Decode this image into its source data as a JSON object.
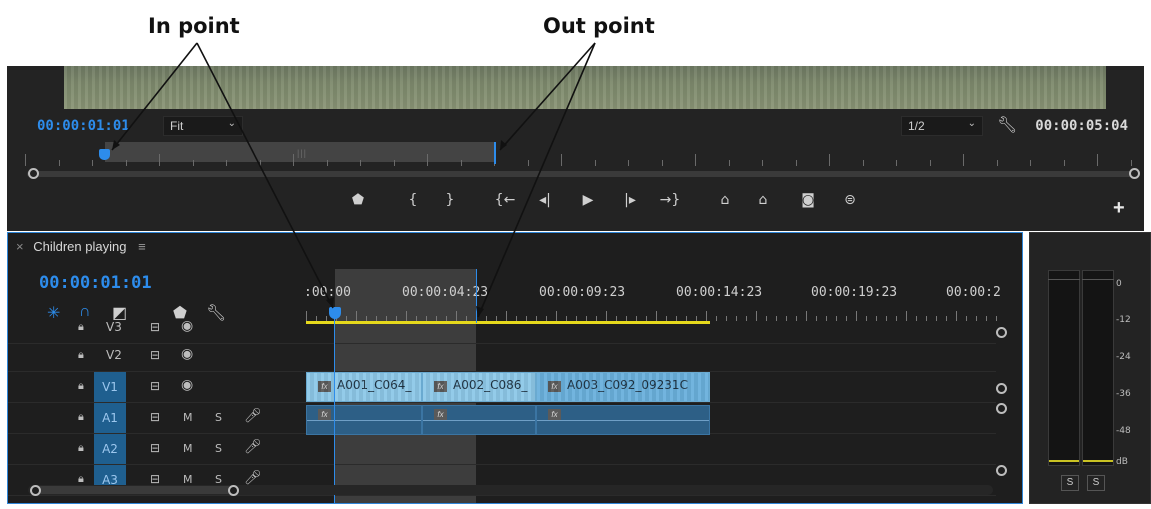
{
  "annotations": {
    "in_point": "In point",
    "out_point": "Out point"
  },
  "program_monitor": {
    "current_timecode": "00:00:01:01",
    "zoom": "Fit",
    "resolution": "1/2",
    "duration": "00:00:05:04",
    "transport_buttons": [
      {
        "name": "add-marker",
        "glyph": "⬟"
      },
      {
        "name": "mark-in",
        "glyph": "{"
      },
      {
        "name": "mark-out",
        "glyph": "}"
      },
      {
        "name": "go-to-in",
        "glyph": "{←"
      },
      {
        "name": "step-back",
        "glyph": "◂|"
      },
      {
        "name": "play",
        "glyph": "▶"
      },
      {
        "name": "step-forward",
        "glyph": "|▸"
      },
      {
        "name": "go-to-out",
        "glyph": "→}"
      },
      {
        "name": "lift",
        "glyph": "⌂"
      },
      {
        "name": "extract",
        "glyph": "⌂"
      },
      {
        "name": "export-frame",
        "glyph": "◙"
      },
      {
        "name": "comparison-view",
        "glyph": "⊜"
      }
    ],
    "add_button": "+"
  },
  "timeline": {
    "sequence_name": "Children playing",
    "timecode": "00:00:01:01",
    "ruler_labels": [
      ":00:00",
      "00:00:04:23",
      "00:00:09:23",
      "00:00:14:23",
      "00:00:19:23",
      "00:00:2"
    ],
    "tracks": [
      {
        "name": "V3",
        "type": "video"
      },
      {
        "name": "V2",
        "type": "video"
      },
      {
        "name": "V1",
        "type": "video",
        "targeted": true
      },
      {
        "name": "A1",
        "type": "audio",
        "targeted": true
      },
      {
        "name": "A2",
        "type": "audio",
        "targeted": true
      },
      {
        "name": "A3",
        "type": "audio",
        "targeted": true
      }
    ],
    "audio_controls": {
      "mute": "M",
      "solo": "S"
    },
    "video_clips": [
      {
        "label": "A001_C064_"
      },
      {
        "label": "A002_C086_"
      },
      {
        "label": "A003_C092_09231C"
      }
    ],
    "fx_badge": "fx"
  },
  "audio_meter": {
    "scale": [
      "0",
      "-12",
      "-24",
      "-36",
      "-48",
      "dB"
    ],
    "solo_buttons": [
      "S",
      "S"
    ]
  }
}
